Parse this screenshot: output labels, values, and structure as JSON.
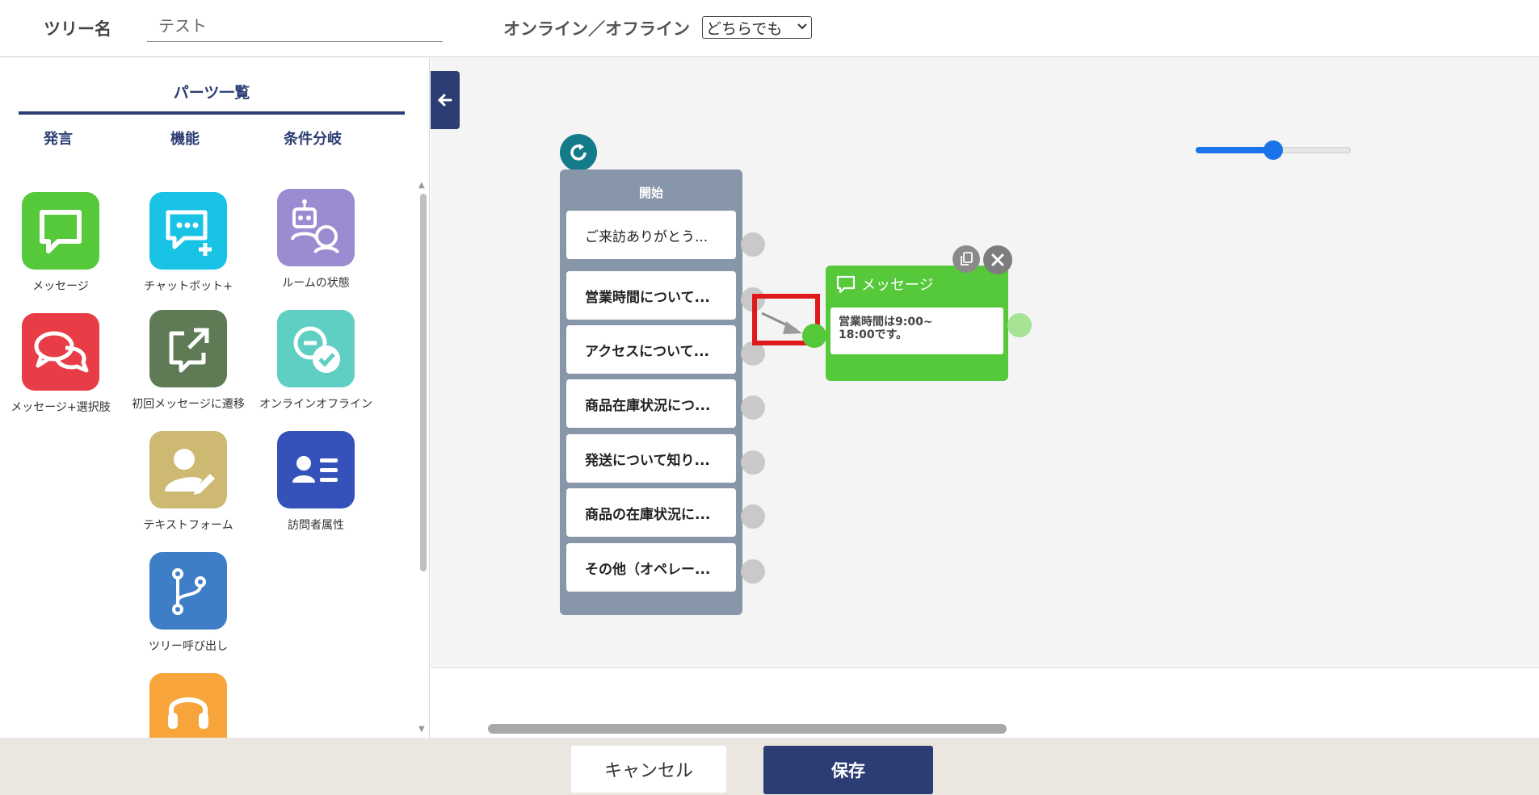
{
  "header": {
    "tree_name_label": "ツリー名",
    "tree_name_value": "テスト",
    "online_label": "オンライン／オフライン",
    "online_select_value": "どちらでも"
  },
  "sidebar": {
    "title": "パーツ一覧",
    "tabs": [
      "発言",
      "機能",
      "条件分岐"
    ],
    "parts": [
      {
        "label": "メッセージ",
        "color": "#55c93a",
        "icon": "message-icon"
      },
      {
        "label": "チャットボット+",
        "color": "#19c3e6",
        "icon": "chatbot-plus-icon"
      },
      {
        "label": "ルームの状態",
        "color": "#9b8bd0",
        "icon": "robot-operator-icon"
      },
      {
        "label": "メッセージ+選択肢",
        "color": "#e83c46",
        "icon": "message-choices-icon"
      },
      {
        "label": "初回メッセージに遷移",
        "color": "#5e7b55",
        "icon": "external-link-icon"
      },
      {
        "label": "オンラインオフライン",
        "color": "#5fcfc4",
        "icon": "online-offline-icon"
      },
      {
        "label": "テキストフォーム",
        "color": "#cdb971",
        "icon": "user-edit-icon"
      },
      {
        "label": "訪問者属性",
        "color": "#3552bb",
        "icon": "id-card-icon"
      },
      {
        "label": "ツリー呼び出し",
        "color": "#3d7ec6",
        "icon": "branch-icon"
      },
      {
        "label": "",
        "color": "#f7a43a",
        "icon": "headset-icon"
      }
    ]
  },
  "canvas": {
    "zoom_fraction": 0.5,
    "start_node": {
      "title": "開始",
      "choices": [
        "ご来訪ありがとう...",
        "営業時間について...",
        "アクセスについて...",
        "商品在庫状況につ...",
        "発送について知り...",
        "商品の在庫状況に...",
        "その他（オペレー..."
      ]
    },
    "message_node": {
      "title": "メッセージ",
      "body_line1": "営業時間は9:00~",
      "body_line2": "18:00です。"
    }
  },
  "footer": {
    "cancel_label": "キャンセル",
    "save_label": "保存"
  }
}
